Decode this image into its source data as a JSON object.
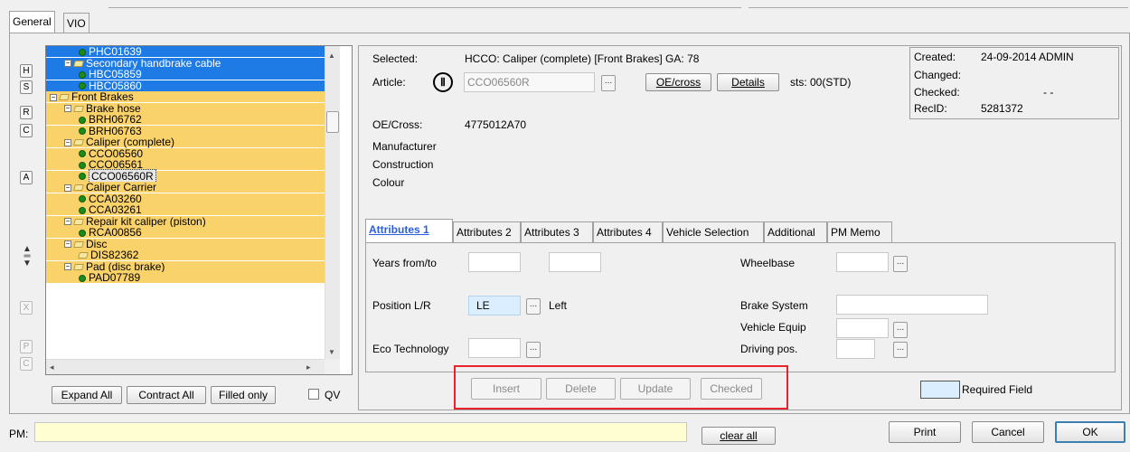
{
  "top_tabs": [
    "General",
    "VIO"
  ],
  "side_buttons": [
    "H",
    "S",
    "R",
    "C",
    "A",
    "X",
    "P",
    "C"
  ],
  "tree": [
    {
      "label": "PHC01639",
      "kind": "leaf",
      "indent": 2,
      "bg": "blue"
    },
    {
      "label": "Secondary handbrake cable",
      "kind": "node",
      "indent": 1,
      "bg": "blue"
    },
    {
      "label": "HBC05859",
      "kind": "leaf",
      "indent": 2,
      "bg": "blue"
    },
    {
      "label": "HBC05860",
      "kind": "leaf",
      "indent": 2,
      "bg": "blue"
    },
    {
      "label": "Front Brakes",
      "kind": "node",
      "indent": 0,
      "bg": "yellow"
    },
    {
      "label": "Brake hose",
      "kind": "node",
      "indent": 1,
      "bg": "yellow"
    },
    {
      "label": "BRH06762",
      "kind": "leaf",
      "indent": 2,
      "bg": "yellow"
    },
    {
      "label": "BRH06763",
      "kind": "leaf",
      "indent": 2,
      "bg": "yellow"
    },
    {
      "label": "Caliper (complete)",
      "kind": "node",
      "indent": 1,
      "bg": "yellow"
    },
    {
      "label": "CCO06560",
      "kind": "leaf",
      "indent": 2,
      "bg": "yellow"
    },
    {
      "label": "CCO06561",
      "kind": "leaf",
      "indent": 2,
      "bg": "yellow"
    },
    {
      "label": "CCO06560R",
      "kind": "leaf",
      "indent": 2,
      "bg": "selected"
    },
    {
      "label": "Caliper Carrier",
      "kind": "node",
      "indent": 1,
      "bg": "yellow"
    },
    {
      "label": "CCA03260",
      "kind": "leaf",
      "indent": 2,
      "bg": "yellow"
    },
    {
      "label": "CCA03261",
      "kind": "leaf",
      "indent": 2,
      "bg": "yellow"
    },
    {
      "label": "Repair kit caliper (piston)",
      "kind": "node",
      "indent": 1,
      "bg": "yellow"
    },
    {
      "label": "RCA00856",
      "kind": "leaf",
      "indent": 2,
      "bg": "yellow"
    },
    {
      "label": "Disc",
      "kind": "node",
      "indent": 1,
      "bg": "yellow"
    },
    {
      "label": "DIS82362",
      "kind": "leafgray",
      "indent": 2,
      "bg": "yellow"
    },
    {
      "label": "Pad (disc brake)",
      "kind": "node",
      "indent": 1,
      "bg": "yellow"
    },
    {
      "label": "PAD07789",
      "kind": "leaf",
      "indent": 2,
      "bg": "yellow"
    }
  ],
  "tree_buttons": {
    "expand": "Expand All",
    "contract": "Contract All",
    "filled": "Filled only",
    "qv": "QV"
  },
  "info": {
    "selected_label": "Selected:",
    "selected_value": "HCCO: Caliper (complete) [Front Brakes] GA: 78",
    "article_label": "Article:",
    "article_value": "CCO06560R",
    "oe_cross_btn": "OE/cross",
    "details_btn": "Details",
    "sts": "sts: 00(STD)",
    "oe_cross_label": "OE/Cross:",
    "oe_cross_value": "4775012A70",
    "manufacturer": "Manufacturer",
    "construction": "Construction",
    "colour": "Colour"
  },
  "meta": {
    "created_label": "Created:",
    "created_value": "24-09-2014 ADMIN",
    "changed_label": "Changed:",
    "changed_value": "",
    "checked_label": "Checked:",
    "checked_value": "- -",
    "recid_label": "RecID:",
    "recid_value": "5281372"
  },
  "attr_tabs": [
    "Attributes 1",
    "Attributes 2",
    "Attributes 3",
    "Attributes 4",
    "Vehicle Selection",
    "Additional",
    "PM Memo"
  ],
  "attrs": {
    "years": "Years from/to",
    "position": "Position L/R",
    "position_value": "LE",
    "position_text": "Left",
    "eco": "Eco Technology",
    "wheelbase": "Wheelbase",
    "brake_system": "Brake System",
    "vehicle_equip": "Vehicle Equip",
    "driving_pos": "Driving pos."
  },
  "actions": [
    "Insert",
    "Delete",
    "Update",
    "Checked"
  ],
  "required_field": "Required Field",
  "pm_label": "PM:",
  "bottom": {
    "clear_all": "clear all",
    "print": "Print",
    "cancel": "Cancel",
    "ok": "OK"
  },
  "colors": {
    "tree_blue": "#1e7be6",
    "tree_yellow": "#fad26a",
    "highlight_red": "#e8232b",
    "required_fill": "#dbeeff",
    "pm_fill": "#ffffd2"
  }
}
